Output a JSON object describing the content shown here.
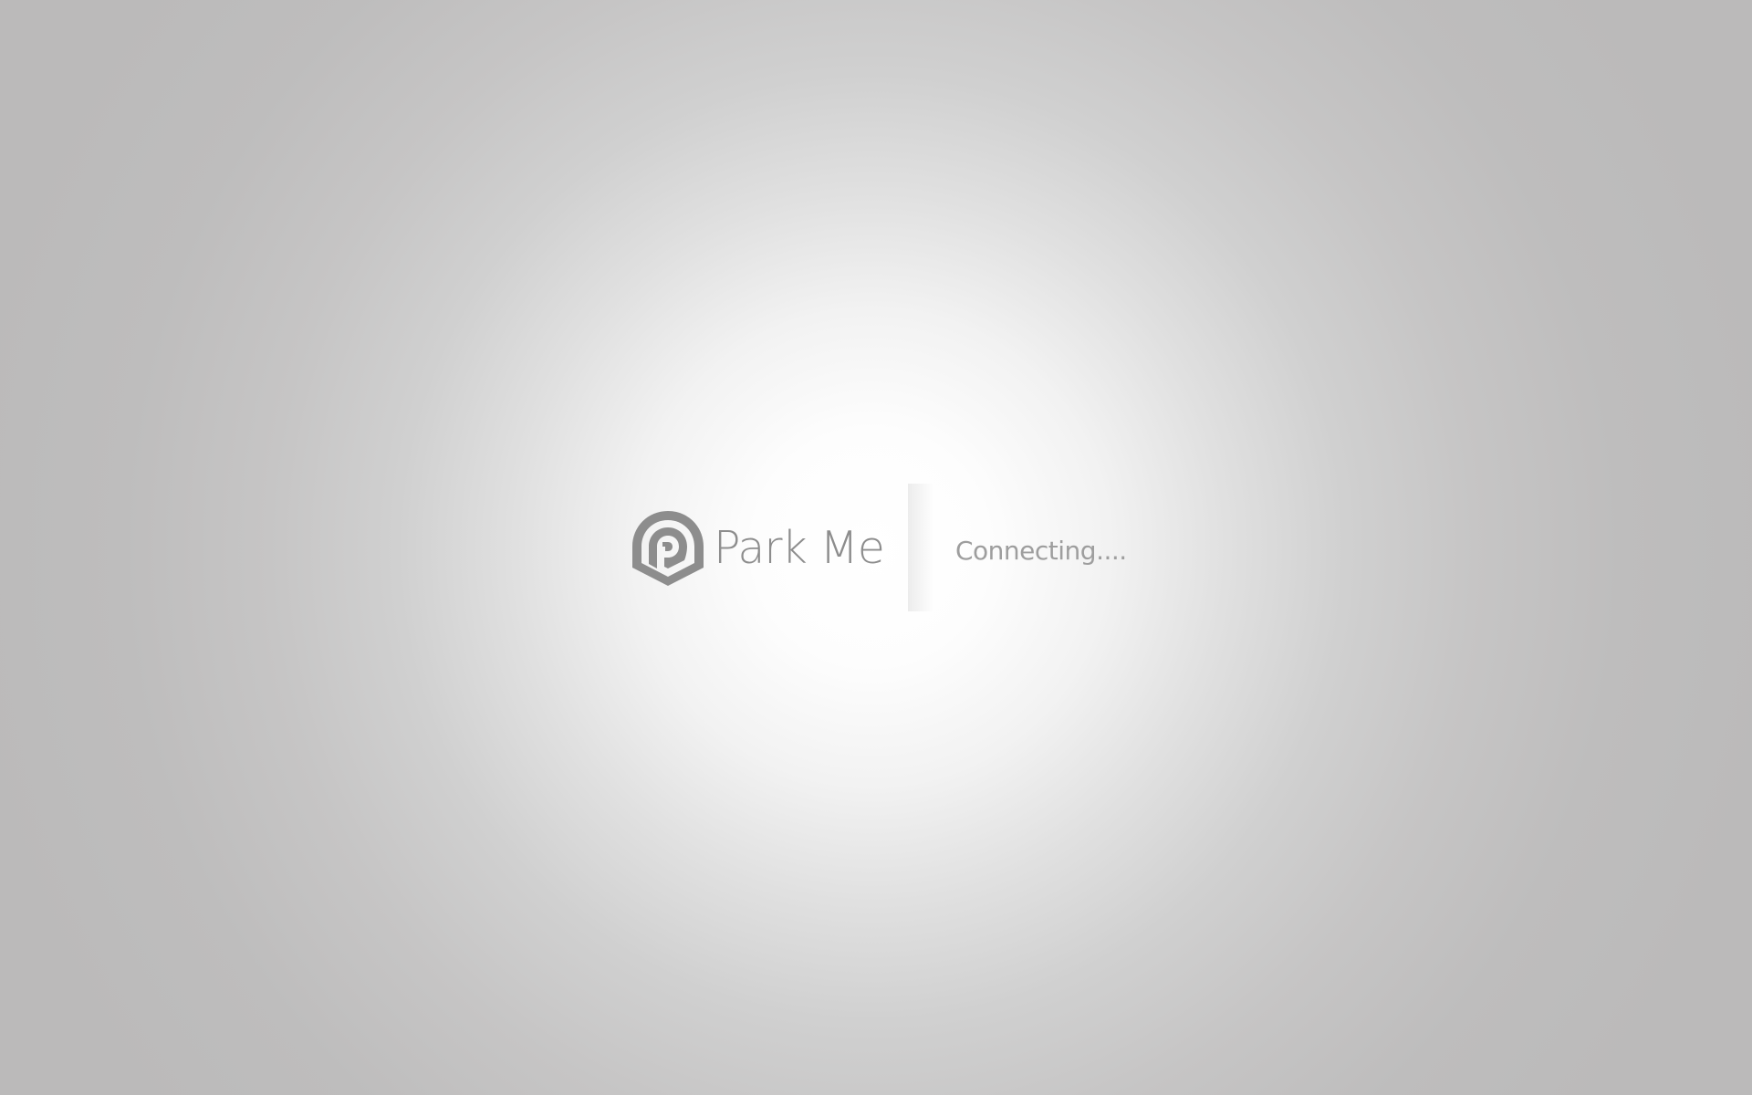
{
  "app": {
    "name": "Park Me",
    "logo_icon": "parking-pin-icon",
    "logo_color": "#8d8d8d"
  },
  "status": {
    "text": "Connecting...."
  },
  "colors": {
    "background_center": "#ffffff",
    "background_edge": "#bbbaba",
    "text": "#9e9e9e"
  }
}
